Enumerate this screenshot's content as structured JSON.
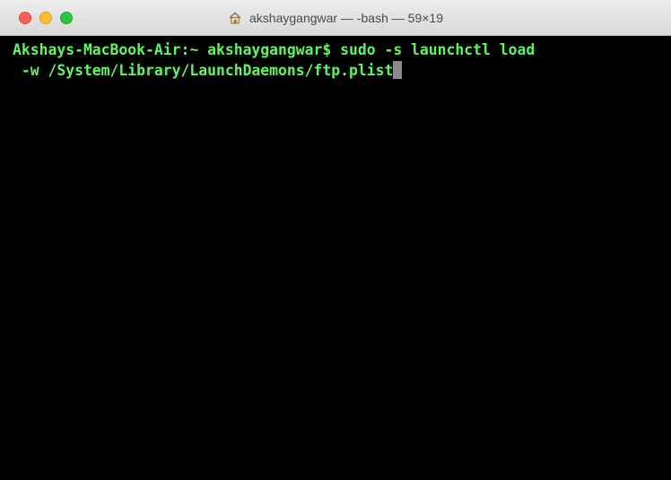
{
  "window": {
    "title": "akshaygangwar — -bash — 59×19",
    "title_icon": "home-icon"
  },
  "terminal": {
    "lines": [
      "Akshays-MacBook-Air:~ akshaygangwar$ sudo -s launchctl load",
      " -w /System/Library/LaunchDaemons/ftp.plist"
    ],
    "text_color": "#5ff55f",
    "background": "#000000"
  },
  "traffic_lights": {
    "close_color": "#fc5f57",
    "minimize_color": "#fdbc2e",
    "zoom_color": "#28c840"
  }
}
